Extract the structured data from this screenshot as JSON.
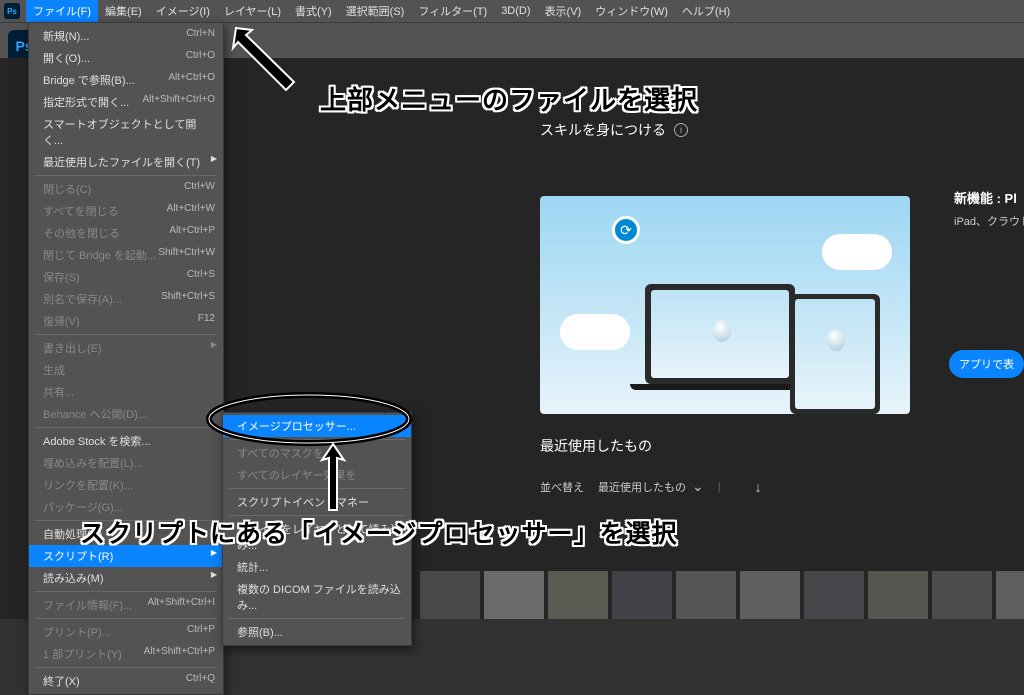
{
  "menubar": {
    "items": [
      "ファイル(F)",
      "編集(E)",
      "イメージ(I)",
      "レイヤー(L)",
      "書式(Y)",
      "選択範囲(S)",
      "フィルター(T)",
      "3D(D)",
      "表示(V)",
      "ウィンドウ(W)",
      "ヘルプ(H)"
    ]
  },
  "dropdown": [
    {
      "label": "新規(N)...",
      "shortcut": "Ctrl+N"
    },
    {
      "label": "開く(O)...",
      "shortcut": "Ctrl+O"
    },
    {
      "label": "Bridge で参照(B)...",
      "shortcut": "Alt+Ctrl+O"
    },
    {
      "label": "指定形式で開く...",
      "shortcut": "Alt+Shift+Ctrl+O"
    },
    {
      "label": "スマートオブジェクトとして開く..."
    },
    {
      "label": "最近使用したファイルを開く(T)",
      "sub": true
    },
    {
      "sep": true
    },
    {
      "label": "閉じる(C)",
      "shortcut": "Ctrl+W",
      "disabled": true
    },
    {
      "label": "すべてを閉じる",
      "shortcut": "Alt+Ctrl+W",
      "disabled": true
    },
    {
      "label": "その他を閉じる",
      "shortcut": "Alt+Ctrl+P",
      "disabled": true
    },
    {
      "label": "閉じて Bridge を起動...",
      "shortcut": "Shift+Ctrl+W",
      "disabled": true
    },
    {
      "label": "保存(S)",
      "shortcut": "Ctrl+S",
      "disabled": true
    },
    {
      "label": "別名で保存(A)...",
      "shortcut": "Shift+Ctrl+S",
      "disabled": true
    },
    {
      "label": "復帰(V)",
      "shortcut": "F12",
      "disabled": true
    },
    {
      "sep": true
    },
    {
      "label": "書き出し(E)",
      "sub": true,
      "disabled": true
    },
    {
      "label": "生成",
      "disabled": true
    },
    {
      "label": "共有...",
      "disabled": true
    },
    {
      "label": "Behance へ公開(D)...",
      "disabled": true
    },
    {
      "sep": true
    },
    {
      "label": "Adobe Stock を検索..."
    },
    {
      "label": "埋め込みを配置(L)...",
      "disabled": true
    },
    {
      "label": "リンクを配置(K)...",
      "disabled": true
    },
    {
      "label": "パッケージ(G)...",
      "disabled": true
    },
    {
      "sep": true
    },
    {
      "label": "自動処理(U)",
      "sub": true
    },
    {
      "label": "スクリプト(R)",
      "sub": true,
      "highlight": true
    },
    {
      "label": "読み込み(M)",
      "sub": true
    },
    {
      "sep": true
    },
    {
      "label": "ファイル情報(F)...",
      "shortcut": "Alt+Shift+Ctrl+I",
      "disabled": true
    },
    {
      "sep": true
    },
    {
      "label": "プリント(P)...",
      "shortcut": "Ctrl+P",
      "disabled": true
    },
    {
      "label": "1 部プリント(Y)",
      "shortcut": "Alt+Shift+Ctrl+P",
      "disabled": true
    },
    {
      "sep": true
    },
    {
      "label": "終了(X)",
      "shortcut": "Ctrl+Q"
    }
  ],
  "submenu": [
    {
      "label": "イメージプロセッサー...",
      "highlight": true
    },
    {
      "sep": true
    },
    {
      "label": "すべてのマスクを",
      "disabled": true
    },
    {
      "label": "すべてのレイヤー効果を",
      "disabled": true
    },
    {
      "sep": true
    },
    {
      "label": "スクリプトイベントマネー"
    },
    {
      "sep": true
    },
    {
      "label": "ファイルをレイヤーとして読み込み..."
    },
    {
      "label": "統計..."
    },
    {
      "label": "複数の DICOM ファイルを読み込み..."
    },
    {
      "sep": true
    },
    {
      "label": "参照(B)..."
    }
  ],
  "home": {
    "skill_header": "スキルを身につける",
    "new_feature_title": "新機能 : Pl",
    "new_feature_desc": "iPad、クラウドド",
    "app_button": "アプリで表",
    "recent_title": "最近使用したもの",
    "sort_label": "並べ替え",
    "sort_value": "最近使用したもの"
  },
  "annotations": {
    "top": "上部メニューのファイルを選択",
    "bottom": "スクリプトにある「イメージプロセッサー」を選択"
  }
}
